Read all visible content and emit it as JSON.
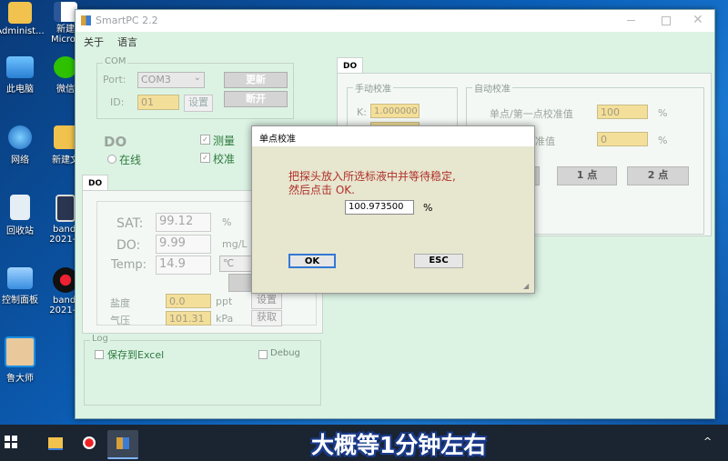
{
  "desktop": {
    "icons": [
      {
        "label": "Administ..."
      },
      {
        "label": "此电脑"
      },
      {
        "label": "网络"
      },
      {
        "label": "回收站"
      },
      {
        "label": "控制面板"
      },
      {
        "label": "鲁大师"
      },
      {
        "label": "新建\nMicros"
      },
      {
        "label": "微信"
      },
      {
        "label": "新建文"
      },
      {
        "label": "bandi\n2021-0"
      },
      {
        "label": "bandi\n2021-0"
      }
    ]
  },
  "window": {
    "title": "SmartPC 2.2",
    "menu": [
      "关于",
      "语言"
    ],
    "com": {
      "group_title": "COM",
      "port_label": "Port:",
      "port_value": "COM3",
      "refresh_button": "更新",
      "id_label": "ID:",
      "id_value": "01",
      "set_button": "设置",
      "open_button": "断开"
    },
    "do_section": {
      "title": "DO",
      "online_label": "在线",
      "measure_label": "测量",
      "calibrate_label": "校准"
    },
    "left_tab": "DO",
    "readings": {
      "sat_label": "SAT:",
      "sat_value": "99.12",
      "sat_unit": "%",
      "do_label": "DO:",
      "do_value": "9.99",
      "do_unit": "mg/L",
      "temp_label": "Temp:",
      "temp_value": "14.9",
      "temp_unit": "℃",
      "salinity_label": "盐度",
      "salinity_value": "0.0",
      "salinity_unit": "ppt",
      "salinity_button": "设置",
      "pressure_label": "气压",
      "pressure_value": "101.31",
      "pressure_unit": "kPa",
      "pressure_button": "获取"
    },
    "log": {
      "group_title": "Log",
      "save_excel": "保存到Excel",
      "debug": "Debug"
    },
    "right_tab": "DO",
    "manual": {
      "group_title": "手动校准",
      "k_label": "K:",
      "k_value": "1.000000"
    },
    "auto": {
      "group_title": "自动校准",
      "single_label": "单点/第一点校准值",
      "single_value": "100",
      "single_unit": "%",
      "second_label": "准值",
      "second_value": "0",
      "second_unit": "%",
      "one_point_button": "1 点",
      "two_point_button": "2 点"
    }
  },
  "dialog": {
    "title": "单点校准",
    "message_line1": "把探头放入所选标液中并等待稳定,",
    "message_line2": "然后点击 OK.",
    "input_value": "100.973500",
    "unit": "%",
    "ok_button": "OK",
    "esc_button": "ESC"
  },
  "caption": "大概等1分钟左右",
  "colors": {
    "window_bg": "#dcf3e4",
    "field_bg": "#f4df9a",
    "dialog_bg": "#e7e6cf",
    "dialog_text": "#b0302a",
    "do_text": "#2f7a3e"
  }
}
